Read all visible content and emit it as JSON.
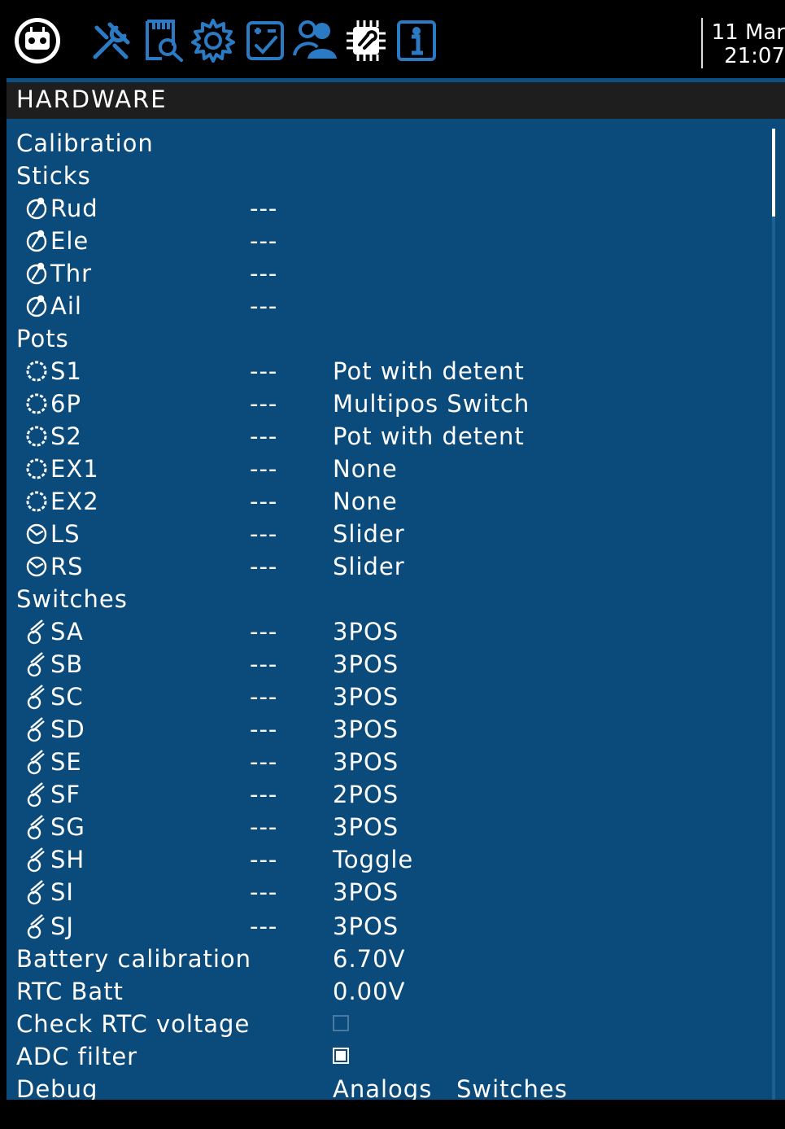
{
  "topbar": {
    "icons": [
      "radio-menu-icon",
      "model-tools-icon",
      "sd-card-icon",
      "settings-gear-icon",
      "checklist-icon",
      "users-icon",
      "hardware-chip-icon",
      "info-icon"
    ],
    "date": "11 Mar",
    "time": "21:07"
  },
  "page": {
    "title": "HARDWARE"
  },
  "sections": {
    "calibration": "Calibration",
    "sticks": "Sticks",
    "pots": "Pots",
    "switches": "Switches"
  },
  "sticks": [
    {
      "name": "Rud",
      "value": "---"
    },
    {
      "name": "Ele",
      "value": "---"
    },
    {
      "name": "Thr",
      "value": "---"
    },
    {
      "name": "Ail",
      "value": "---"
    }
  ],
  "pots": [
    {
      "name": "S1",
      "value": "---",
      "type": "Pot with detent",
      "icon": "pot-knob-icon"
    },
    {
      "name": "6P",
      "value": "---",
      "type": "Multipos Switch",
      "icon": "pot-knob-icon"
    },
    {
      "name": "S2",
      "value": "---",
      "type": "Pot with detent",
      "icon": "pot-knob-icon"
    },
    {
      "name": "EX1",
      "value": "---",
      "type": "None",
      "icon": "pot-knob-icon"
    },
    {
      "name": "EX2",
      "value": "---",
      "type": "None",
      "icon": "pot-knob-icon"
    },
    {
      "name": "LS",
      "value": "---",
      "type": "Slider",
      "icon": "slider-icon"
    },
    {
      "name": "RS",
      "value": "---",
      "type": "Slider",
      "icon": "slider-icon"
    }
  ],
  "switches": [
    {
      "name": "SA",
      "value": "---",
      "type": "3POS"
    },
    {
      "name": "SB",
      "value": "---",
      "type": "3POS"
    },
    {
      "name": "SC",
      "value": "---",
      "type": "3POS"
    },
    {
      "name": "SD",
      "value": "---",
      "type": "3POS"
    },
    {
      "name": "SE",
      "value": "---",
      "type": "3POS"
    },
    {
      "name": "SF",
      "value": "---",
      "type": "2POS"
    },
    {
      "name": "SG",
      "value": "---",
      "type": "3POS"
    },
    {
      "name": "SH",
      "value": "---",
      "type": "Toggle"
    },
    {
      "name": "SI",
      "value": "---",
      "type": "3POS"
    },
    {
      "name": "SJ",
      "value": "---",
      "type": "3POS"
    }
  ],
  "battery": {
    "label": "Battery calibration",
    "value": "6.70V"
  },
  "rtc": {
    "label": "RTC Batt",
    "value": "0.00V"
  },
  "check_rtc": {
    "label": "Check RTC voltage",
    "checked": false
  },
  "adc_filter": {
    "label": "ADC filter",
    "checked": true
  },
  "debug": {
    "label": "Debug",
    "analogs": "Analogs",
    "switches": "Switches"
  },
  "colors": {
    "background": "#0b4b7c",
    "titlebar": "#1e1e1e",
    "accent": "#0b4f84",
    "text": "#ffffff"
  }
}
